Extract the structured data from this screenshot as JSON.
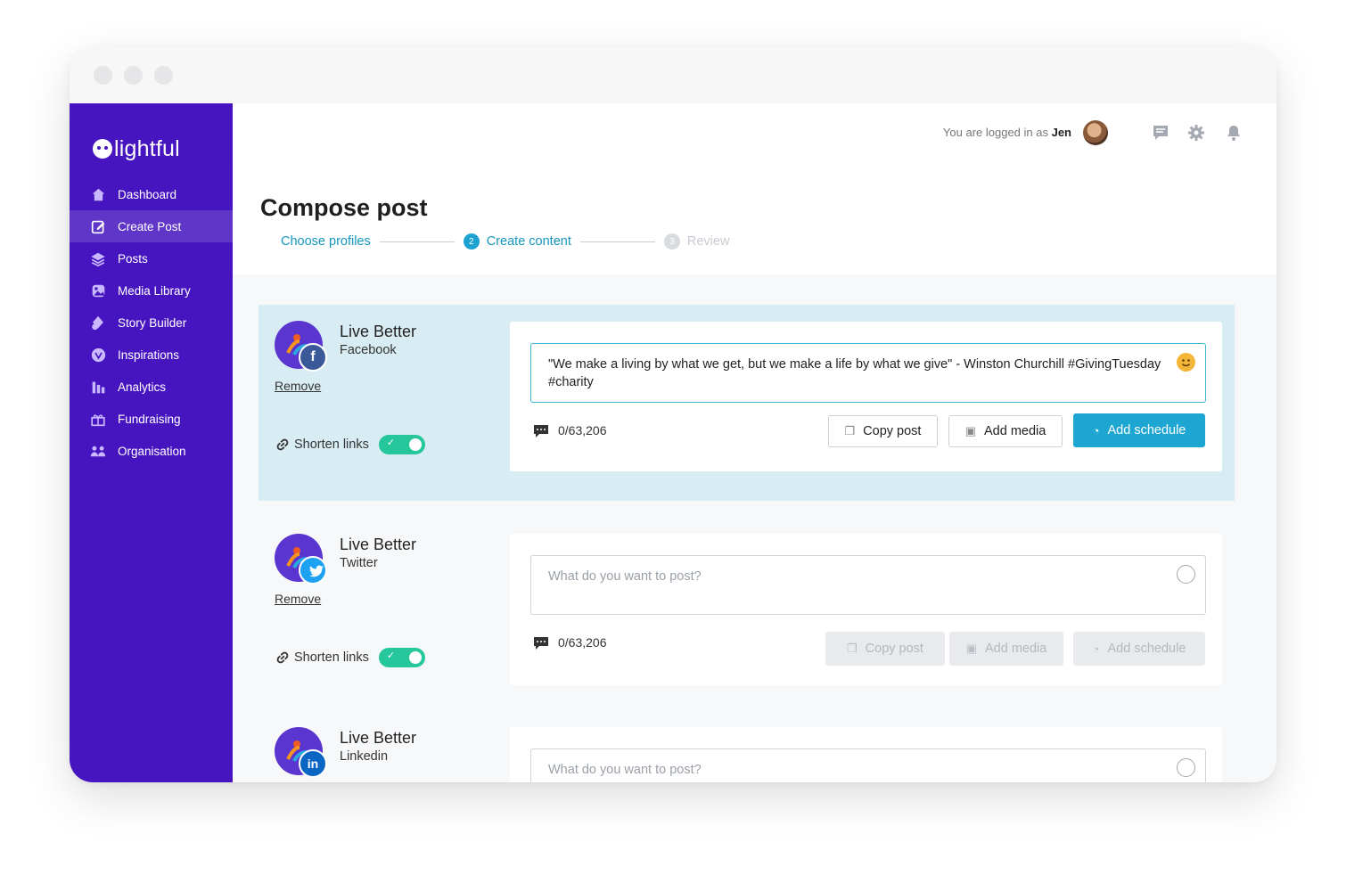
{
  "brand": {
    "logo_text": "lightful"
  },
  "sidebar": {
    "items": [
      {
        "label": "Dashboard",
        "icon": "home-icon"
      },
      {
        "label": "Create Post",
        "icon": "edit-icon",
        "active": true
      },
      {
        "label": "Posts",
        "icon": "layers-icon"
      },
      {
        "label": "Media Library",
        "icon": "image-icon"
      },
      {
        "label": "Story Builder",
        "icon": "shapes-icon"
      },
      {
        "label": "Inspirations",
        "icon": "heart-icon"
      },
      {
        "label": "Analytics",
        "icon": "bar-chart-icon"
      },
      {
        "label": "Fundraising",
        "icon": "gift-icon"
      },
      {
        "label": "Organisation",
        "icon": "users-icon"
      }
    ]
  },
  "topbar": {
    "logged_in_prefix": "You are logged in as ",
    "user": "Jen"
  },
  "page": {
    "title": "Compose post"
  },
  "steps": [
    {
      "label": "Choose profiles",
      "state": "done"
    },
    {
      "num": "2",
      "label": "Create content",
      "state": "current"
    },
    {
      "num": "3",
      "label": "Review",
      "state": "upcoming"
    }
  ],
  "posts": [
    {
      "profile_name": "Live Better",
      "network": "Facebook",
      "network_letter": "f",
      "network_color": "#3b5998",
      "remove_label": "Remove",
      "shorten_label": "Shorten links",
      "text": "\"We make a living by what we get, but we make a life by what we give\" - Winston Churchill #GivingTuesday #charity",
      "counter": "0/63,206",
      "copy_label": "Copy post",
      "media_label": "Add media",
      "schedule_label": "Add schedule"
    },
    {
      "profile_name": "Live Better",
      "network": "Twitter",
      "network_color": "#1da1f2",
      "remove_label": "Remove",
      "shorten_label": "Shorten links",
      "placeholder": "What do you want to post?",
      "counter": "0/63,206",
      "copy_label": "Copy post",
      "media_label": "Add media",
      "schedule_label": "Add schedule"
    },
    {
      "profile_name": "Live Better",
      "network": "Linkedin",
      "network_letter": "in",
      "network_color": "#0a66c2",
      "placeholder": "What do you want to post?"
    }
  ],
  "colors": {
    "sidebar": "#4615c0",
    "accent": "#1da6d2",
    "toggle": "#26c79b"
  }
}
